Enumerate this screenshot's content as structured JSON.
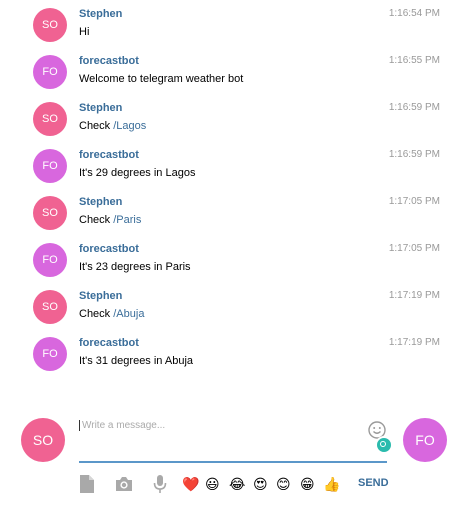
{
  "messages": [
    {
      "sender": "Stephen",
      "initials": "SO",
      "avatar": "so",
      "time": "1:16:54 PM",
      "text": "Hi",
      "command": ""
    },
    {
      "sender": "forecastbot",
      "initials": "FO",
      "avatar": "fo",
      "time": "1:16:55 PM",
      "text": "Welcome to telegram weather bot",
      "command": ""
    },
    {
      "sender": "Stephen",
      "initials": "SO",
      "avatar": "so",
      "time": "1:16:59 PM",
      "text": "Check ",
      "command": "/Lagos"
    },
    {
      "sender": "forecastbot",
      "initials": "FO",
      "avatar": "fo",
      "time": "1:16:59 PM",
      "text": "It's 29 degrees in Lagos",
      "command": ""
    },
    {
      "sender": "Stephen",
      "initials": "SO",
      "avatar": "so",
      "time": "1:17:05 PM",
      "text": "Check ",
      "command": "/Paris"
    },
    {
      "sender": "forecastbot",
      "initials": "FO",
      "avatar": "fo",
      "time": "1:17:05 PM",
      "text": "It's 23 degrees in Paris",
      "command": ""
    },
    {
      "sender": "Stephen",
      "initials": "SO",
      "avatar": "so",
      "time": "1:17:19 PM",
      "text": "Check ",
      "command": "/Abuja"
    },
    {
      "sender": "forecastbot",
      "initials": "FO",
      "avatar": "fo",
      "time": "1:17:19 PM",
      "text": "It's 31 degrees in Abuja",
      "command": ""
    }
  ],
  "composer": {
    "me_initials": "SO",
    "peer_initials": "FO",
    "placeholder": "Write a message...",
    "value": "",
    "send_label": "SEND"
  },
  "toolbar": {
    "icons": [
      "file-icon",
      "camera-icon",
      "microphone-icon"
    ],
    "emojis": [
      {
        "name": "heart-emoji",
        "glyph": "❤️"
      },
      {
        "name": "smiley-emoji",
        "glyph": "😃"
      },
      {
        "name": "tears-of-joy-emoji",
        "glyph": "😂"
      },
      {
        "name": "heart-eyes-emoji",
        "glyph": "😍"
      },
      {
        "name": "blush-emoji",
        "glyph": "😊"
      },
      {
        "name": "grin-emoji",
        "glyph": "😁"
      },
      {
        "name": "thumbs-up-emoji",
        "glyph": "👍"
      }
    ]
  },
  "colors": {
    "accent": "#3a6d99",
    "me_avatar": "#f06292",
    "peer_avatar": "#d867de",
    "input_underline": "#5b97c9",
    "online_badge": "#2bbbad"
  }
}
